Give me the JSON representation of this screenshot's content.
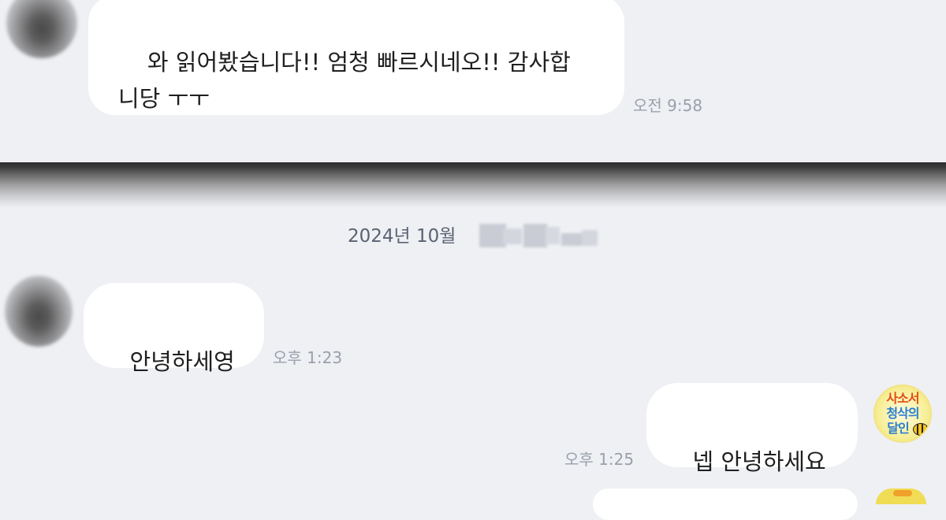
{
  "chat": {
    "messages": [
      {
        "sender": "other",
        "text": "와 읽어봤습니다!! 엄청 빠르시네오!! 감사합\n니당 ㅜㅜ",
        "time": "오전 9:58"
      },
      {
        "sender": "other",
        "text": "안녕하세영",
        "time": "오후 1:23"
      },
      {
        "sender": "me",
        "text": "넵 안녕하세요",
        "time": "오후 1:25"
      }
    ],
    "date_separator": "2024년 10월",
    "my_profile": {
      "logo_lines": [
        "사소서",
        "청삭의",
        "달인"
      ]
    }
  },
  "colors": {
    "background": "#eef0f4",
    "bubble": "#ffffff",
    "text": "#1f1f1f",
    "time": "#9aa0ab",
    "date": "#5a6272",
    "logo_orange": "#e24d16",
    "logo_blue": "#2b7fd0",
    "logo_yellow": "#f7ef9a"
  },
  "icons": {
    "other_avatar": "blurred-avatar-icon",
    "my_avatar": "brand-logo-icon",
    "redaction": "blurred-date-redaction"
  }
}
